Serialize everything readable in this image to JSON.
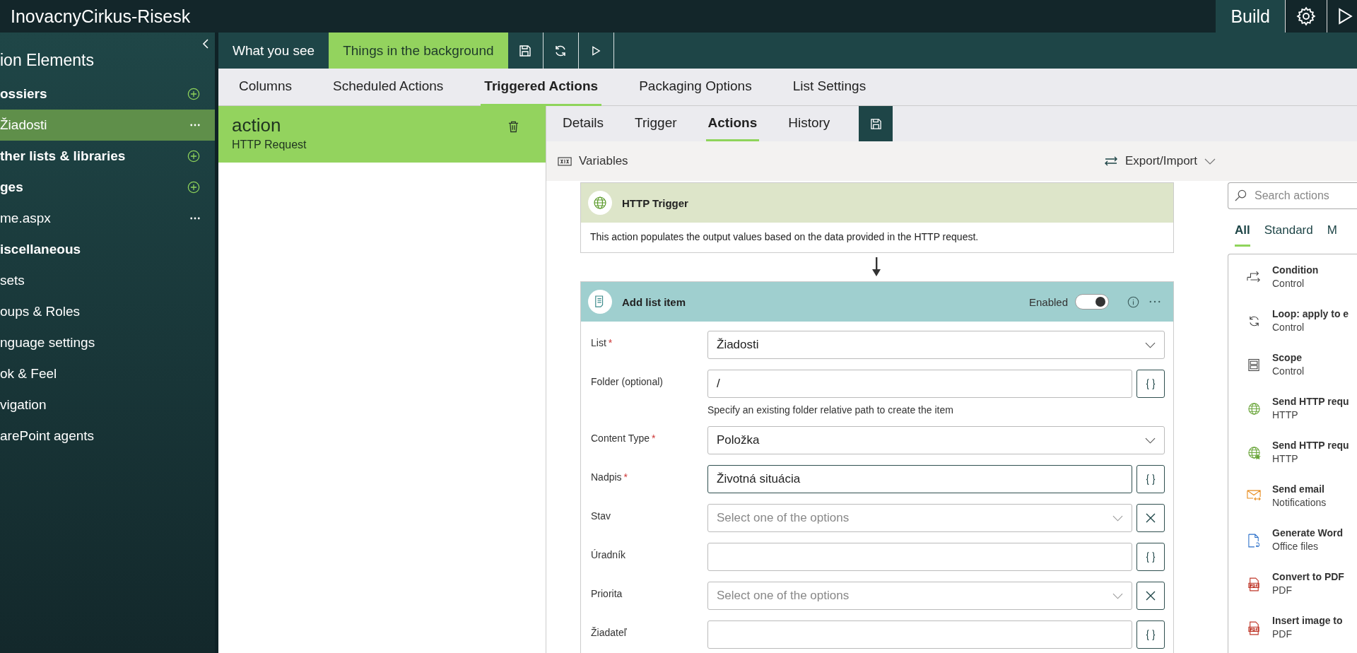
{
  "app_title": "InovacnyCirkus-Risesk",
  "top_tabs": [
    {
      "label": "Build",
      "selected": true
    }
  ],
  "sidebar": {
    "title": "ion Elements",
    "items": [
      {
        "label": "ossiers",
        "kind": "section",
        "add_button": true,
        "menu_button": false,
        "selected": false
      },
      {
        "label": "Žiadosti",
        "kind": "item",
        "add_button": false,
        "menu_button": true,
        "selected": true
      },
      {
        "label": "ther lists & libraries",
        "kind": "section",
        "add_button": true,
        "menu_button": false,
        "selected": false
      },
      {
        "label": "ges",
        "kind": "section",
        "add_button": true,
        "menu_button": false,
        "selected": false
      },
      {
        "label": "me.aspx",
        "kind": "item",
        "add_button": false,
        "menu_button": true,
        "selected": false
      },
      {
        "label": "iscellaneous",
        "kind": "section",
        "add_button": false,
        "menu_button": false,
        "selected": false
      },
      {
        "label": "sets",
        "kind": "item",
        "add_button": false,
        "menu_button": false,
        "selected": false
      },
      {
        "label": "oups & Roles",
        "kind": "item",
        "add_button": false,
        "menu_button": false,
        "selected": false
      },
      {
        "label": "nguage settings",
        "kind": "item",
        "add_button": false,
        "menu_button": false,
        "selected": false
      },
      {
        "label": "ok & Feel",
        "kind": "item",
        "add_button": false,
        "menu_button": false,
        "selected": false
      },
      {
        "label": "vigation",
        "kind": "item",
        "add_button": false,
        "menu_button": false,
        "selected": false
      },
      {
        "label": "arePoint agents",
        "kind": "item",
        "add_button": false,
        "menu_button": false,
        "selected": false
      }
    ]
  },
  "view_tabs": [
    {
      "label": "What you see",
      "selected": false
    },
    {
      "label": "Things in the background",
      "selected": true
    }
  ],
  "list_tabs": [
    {
      "label": "Columns",
      "selected": false
    },
    {
      "label": "Scheduled Actions",
      "selected": false
    },
    {
      "label": "Triggered Actions",
      "selected": true
    },
    {
      "label": "Packaging Options",
      "selected": false
    },
    {
      "label": "List Settings",
      "selected": false
    }
  ],
  "action_card": {
    "title": "action",
    "subtitle": "HTTP Request",
    "selected": true
  },
  "detail_tabs": [
    {
      "label": "Details",
      "selected": false
    },
    {
      "label": "Trigger",
      "selected": false
    },
    {
      "label": "Actions",
      "selected": true
    },
    {
      "label": "History",
      "selected": false
    }
  ],
  "toolbar": {
    "variables": "Variables",
    "export": "Export/Import"
  },
  "trigger": {
    "title": "HTTP Trigger",
    "description": "This action populates the output values based on the data provided in the HTTP request."
  },
  "step": {
    "title": "Add list item",
    "enabled_label": "Enabled",
    "enabled": true,
    "fields": [
      {
        "label": "List",
        "required_mark": "*",
        "kind": "dropdown",
        "value": "Žiadosti",
        "focused": false
      },
      {
        "label": "Folder (optional)",
        "kind": "text",
        "value": "/",
        "hint": "Specify an existing folder relative path to create the item",
        "focused": false
      },
      {
        "label": "Content Type",
        "required_mark": "*",
        "kind": "dropdown",
        "value": "Položka",
        "focused": false
      },
      {
        "label": "Nadpis",
        "required_mark": "*",
        "kind": "text",
        "value": "Životná situácia",
        "focused": true
      },
      {
        "label": "Stav",
        "kind": "choice",
        "placeholder": "Select one of the options",
        "focused": false
      },
      {
        "label": "Úradník",
        "kind": "text",
        "focused": false
      },
      {
        "label": "Priorita",
        "kind": "choice",
        "placeholder": "Select one of the options",
        "focused": false
      },
      {
        "label": "Žiadateľ",
        "kind": "text",
        "focused": false
      }
    ]
  },
  "actions_panel": {
    "search_placeholder": "Search actions",
    "tabs": [
      {
        "label": "All",
        "selected": true
      },
      {
        "label": "Standard",
        "selected": false
      },
      {
        "label": "M",
        "selected": false
      }
    ],
    "items": [
      {
        "title": "Condition",
        "category": "Control",
        "kind": "condition"
      },
      {
        "title": "Loop: apply to e",
        "category": "Control",
        "kind": "loop"
      },
      {
        "title": "Scope",
        "category": "Control",
        "kind": "scope"
      },
      {
        "title": "Send HTTP requ",
        "category": "HTTP",
        "kind": "globe"
      },
      {
        "title": "Send HTTP requ",
        "category": "HTTP",
        "kind": "globe-star"
      },
      {
        "title": "Send email",
        "category": "Notifications",
        "kind": "email"
      },
      {
        "title": "Generate Word",
        "category": "Office files",
        "kind": "word"
      },
      {
        "title": "Convert to PDF",
        "category": "PDF",
        "kind": "pdf"
      },
      {
        "title": "Insert image to",
        "category": "PDF",
        "kind": "pdf"
      }
    ]
  }
}
